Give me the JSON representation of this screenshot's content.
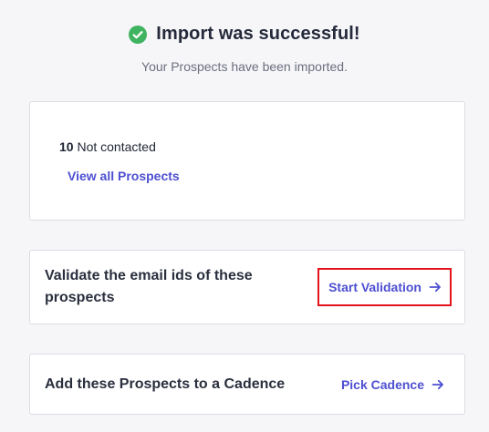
{
  "header": {
    "title": "Import was successful!",
    "subtitle": "Your Prospects have been imported.",
    "status_icon": "check-circle-icon",
    "status_color": "#3fb35f"
  },
  "stats": {
    "count": "10",
    "label": "Not contacted",
    "view_all_link": "View all Prospects"
  },
  "validate": {
    "text": "Validate the email ids of these prospects",
    "link": "Start Validation",
    "link_icon": "arrow-right-icon",
    "highlight_color": "#e3131c"
  },
  "cadence": {
    "text": "Add these Prospects to a Cadence",
    "link": "Pick Cadence",
    "link_icon": "arrow-right-icon"
  },
  "colors": {
    "accent": "#4d4fd1",
    "background": "#f6f6f9",
    "card": "#ffffff",
    "border": "#dcdde3"
  }
}
